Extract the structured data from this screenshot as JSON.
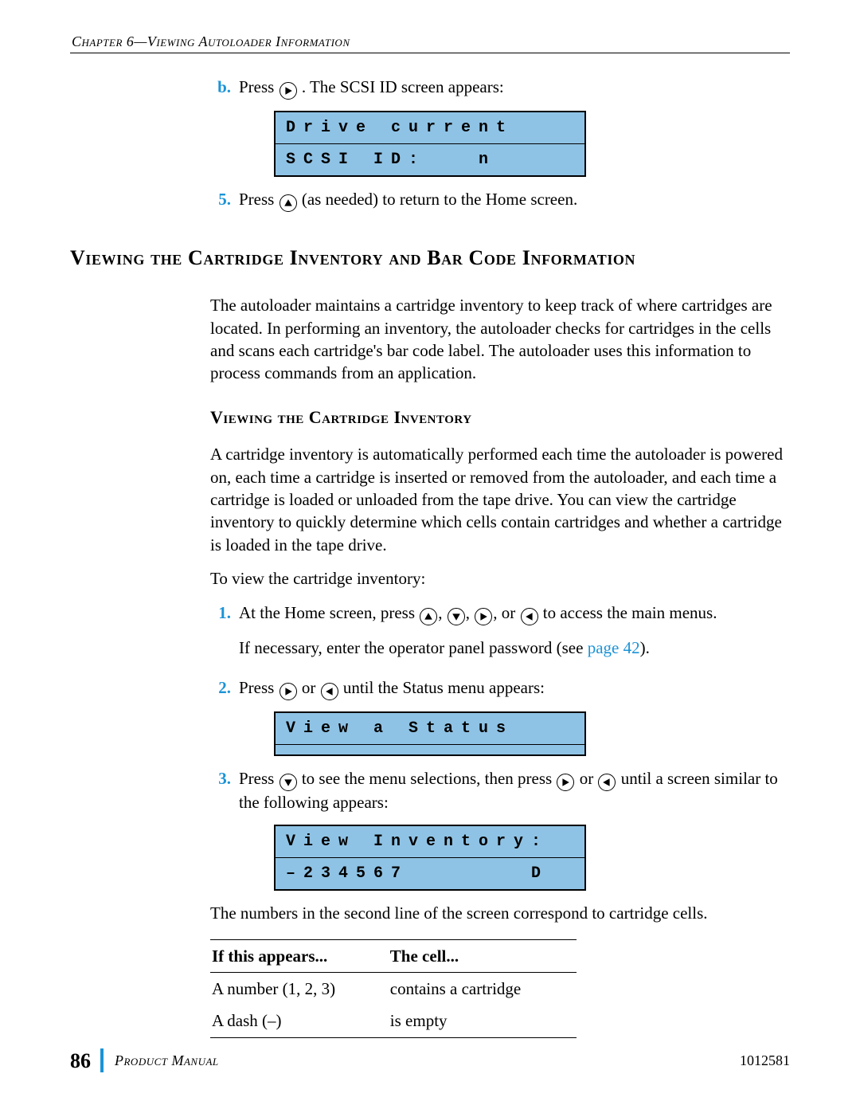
{
  "header": {
    "running": "Chapter 6—Viewing Autoloader Information"
  },
  "top": {
    "b_label": "b.",
    "b_text_pre": "Press ",
    "b_text_post": ". The SCSI ID screen appears:",
    "step5_num": "5.",
    "step5_pre": "Press ",
    "step5_post": " (as needed) to return to the Home screen."
  },
  "lcd1": {
    "row1": [
      "D",
      "r",
      "i",
      "v",
      "e",
      "",
      "c",
      "u",
      "r",
      "r",
      "e",
      "n",
      "t",
      "",
      "",
      ""
    ],
    "row2": [
      "S",
      "C",
      "S",
      "I",
      "",
      "I",
      "D",
      ":",
      "",
      "",
      "",
      "n",
      "",
      "",
      "",
      ""
    ]
  },
  "section": {
    "title": "Viewing the Cartridge Inventory and Bar Code Information",
    "intro": "The autoloader maintains a cartridge inventory to keep track of where cartridges are located. In performing an inventory, the autoloader checks for cartridges in the cells and scans each cartridge's bar code label. The autoloader uses this information to process commands from an application."
  },
  "sub": {
    "title": "Viewing the Cartridge Inventory",
    "p1": "A cartridge inventory is automatically performed each time the autoloader is powered on, each time a cartridge is inserted or removed from the autoloader, and each time a cartridge is loaded or unloaded from the tape drive. You can view the cartridge inventory to quickly determine which cells contain cartridges and whether a cartridge is loaded in the tape drive.",
    "p2": "To view the cartridge inventory:"
  },
  "steps": {
    "s1_num": "1.",
    "s1_pre": "At the Home screen, press ",
    "s1_mid1": ", ",
    "s1_mid2": ", ",
    "s1_mid3": ", or ",
    "s1_post": " to access the main menus.",
    "s1_note_pre": "If necessary, enter the operator panel password (see ",
    "s1_note_link": "page 42",
    "s1_note_post": ").",
    "s2_num": "2.",
    "s2_pre": "Press ",
    "s2_mid": " or ",
    "s2_post": " until the Status menu appears:",
    "s3_num": "3.",
    "s3_pre": "Press ",
    "s3_mid1": " to see the menu selections, then press ",
    "s3_mid2": " or ",
    "s3_post": " until a screen similar to the following appears:",
    "after3": "The numbers in the second line of the screen correspond to cartridge cells."
  },
  "lcd2": {
    "row1": [
      "V",
      "i",
      "e",
      "w",
      "",
      "a",
      "",
      "S",
      "t",
      "a",
      "t",
      "u",
      "s",
      "",
      "",
      ""
    ],
    "row2": [
      "",
      "",
      "",
      "",
      "",
      "",
      "",
      "",
      "",
      "",
      "",
      "",
      "",
      "",
      "",
      ""
    ]
  },
  "lcd3": {
    "row1": [
      "V",
      "i",
      "e",
      "w",
      "",
      "I",
      "n",
      "v",
      "e",
      "n",
      "t",
      "o",
      "r",
      "y",
      ":",
      ""
    ],
    "row2": [
      "–",
      "2",
      "3",
      "4",
      "5",
      "6",
      "7",
      "",
      "",
      "",
      "",
      "",
      "",
      "",
      "D",
      ""
    ]
  },
  "table": {
    "h1": "If this appears...",
    "h2": "The cell...",
    "r1c1": "A number (1, 2, 3)",
    "r1c2": "contains a cartridge",
    "r2c1": "A dash (–)",
    "r2c2": "is empty"
  },
  "footer": {
    "page": "86",
    "label": "Product Manual",
    "doc": "1012581"
  }
}
